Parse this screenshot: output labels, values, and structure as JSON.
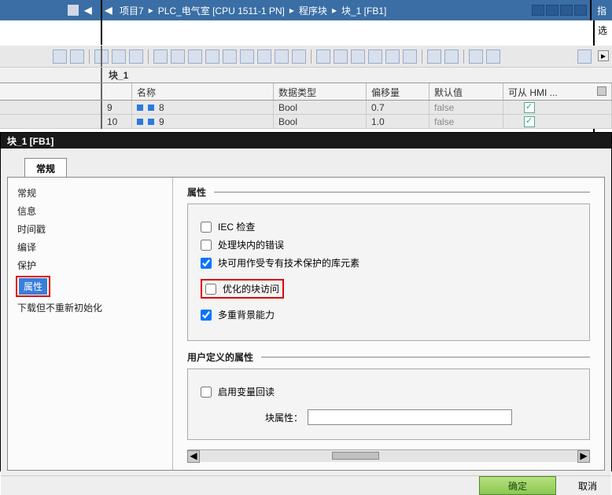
{
  "topbar": {
    "nav": [
      "项目7",
      "PLC_电气室 [CPU 1511-1 PN]",
      "程序块",
      "块_1 [FB1]"
    ],
    "sep": "▸",
    "right_label": "指"
  },
  "row2": {
    "right_label": "选"
  },
  "blockname": "块_1",
  "table": {
    "headers": {
      "name": "名称",
      "type": "数据类型",
      "offset": "偏移量",
      "default": "默认值",
      "hmi": "可从 HMI ..."
    },
    "rows": [
      {
        "idx": "9",
        "name": "8",
        "type": "Bool",
        "offset": "0.7",
        "default": "false"
      },
      {
        "idx": "10",
        "name": "9",
        "type": "Bool",
        "offset": "1.0",
        "default": "false"
      }
    ]
  },
  "dialog": {
    "title": "块_1 [FB1]",
    "tab": "常规",
    "nav": [
      "常规",
      "信息",
      "时间戳",
      "编译",
      "保护",
      "属性",
      "下载但不重新初始化"
    ],
    "content": {
      "attr_title": "属性",
      "opts": {
        "iec": "IEC 检查",
        "err": "处理块内的错误",
        "lib": "块可用作受专有技术保护的库元素",
        "opt": "优化的块访问",
        "multi": "多重背景能力"
      },
      "user_title": "用户定义的属性",
      "readback": "启用变量回读",
      "blockattr_label": "块属性："
    },
    "ok": "确定",
    "cancel": "取消"
  }
}
